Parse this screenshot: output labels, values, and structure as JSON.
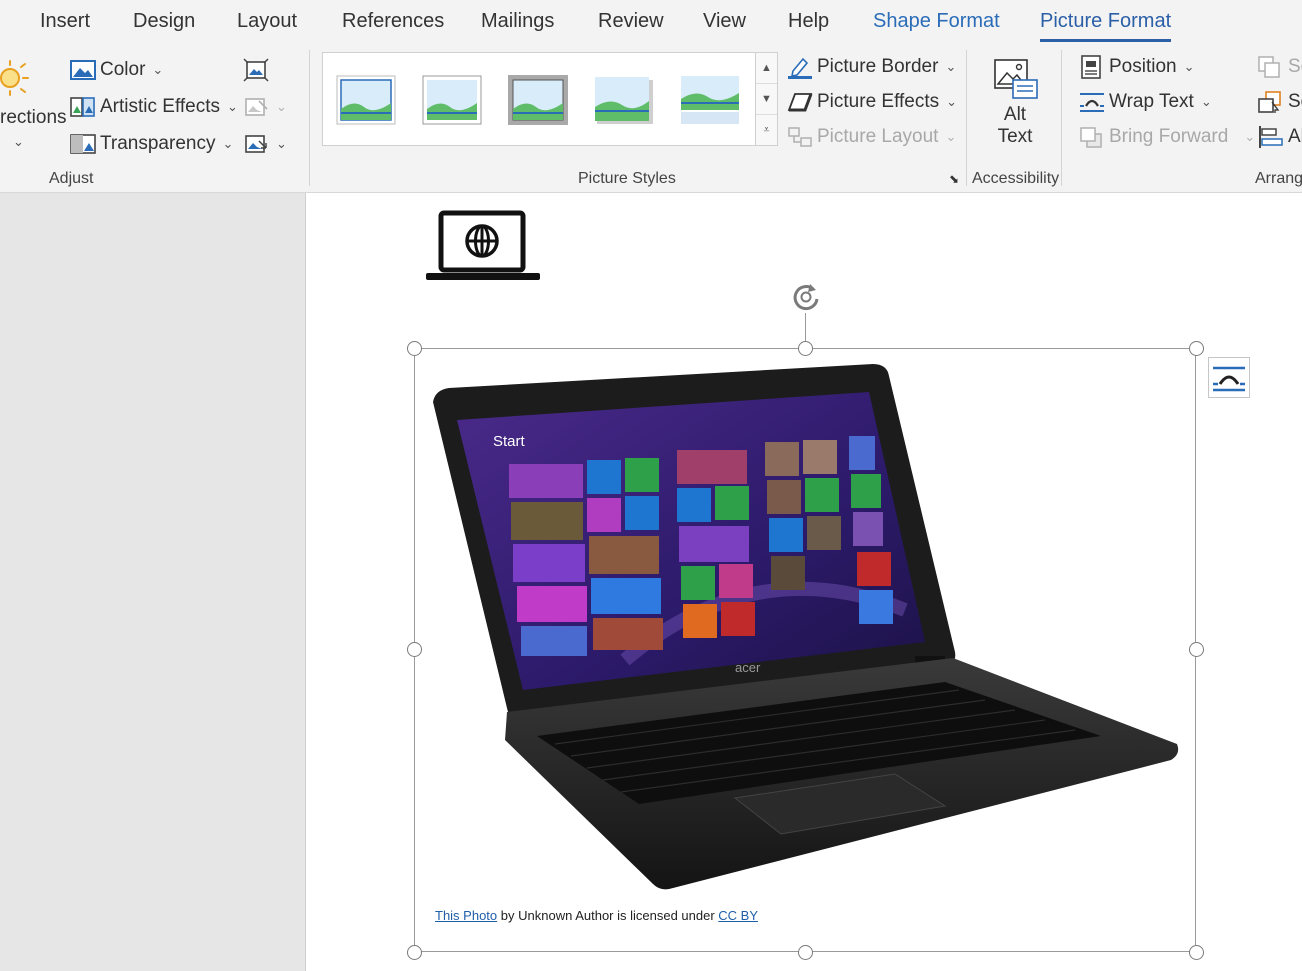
{
  "tabs": {
    "insert": "Insert",
    "design": "Design",
    "layout": "Layout",
    "references": "References",
    "mailings": "Mailings",
    "review": "Review",
    "view": "View",
    "help": "Help",
    "shape_format": "Shape Format",
    "picture_format": "Picture Format"
  },
  "adjust": {
    "corrections_partial": "rections",
    "color": "Color",
    "artistic_effects": "Artistic Effects",
    "transparency": "Transparency",
    "group_label": "Adjust"
  },
  "picture_styles": {
    "picture_border": "Picture Border",
    "picture_effects": "Picture Effects",
    "picture_layout": "Picture Layout",
    "group_label": "Picture Styles"
  },
  "accessibility": {
    "alt_line1": "Alt",
    "alt_line2": "Text",
    "group_label": "Accessibility"
  },
  "arrange": {
    "position": "Position",
    "wrap_text": "Wrap Text",
    "bring_forward": "Bring Forward",
    "selection_partial": "Se",
    "send_partial": "Se",
    "align_partial": "Al",
    "group_label": "Arrang"
  },
  "caption": {
    "link1": "This Photo",
    "middle": " by Unknown  Author is licensed under ",
    "link2": "CC BY"
  },
  "colors": {
    "accent": "#2b5fa7",
    "ribbon_bg": "#f3f3f3",
    "nav_pane": "#e6e6e6",
    "link": "#1f5fa8"
  }
}
